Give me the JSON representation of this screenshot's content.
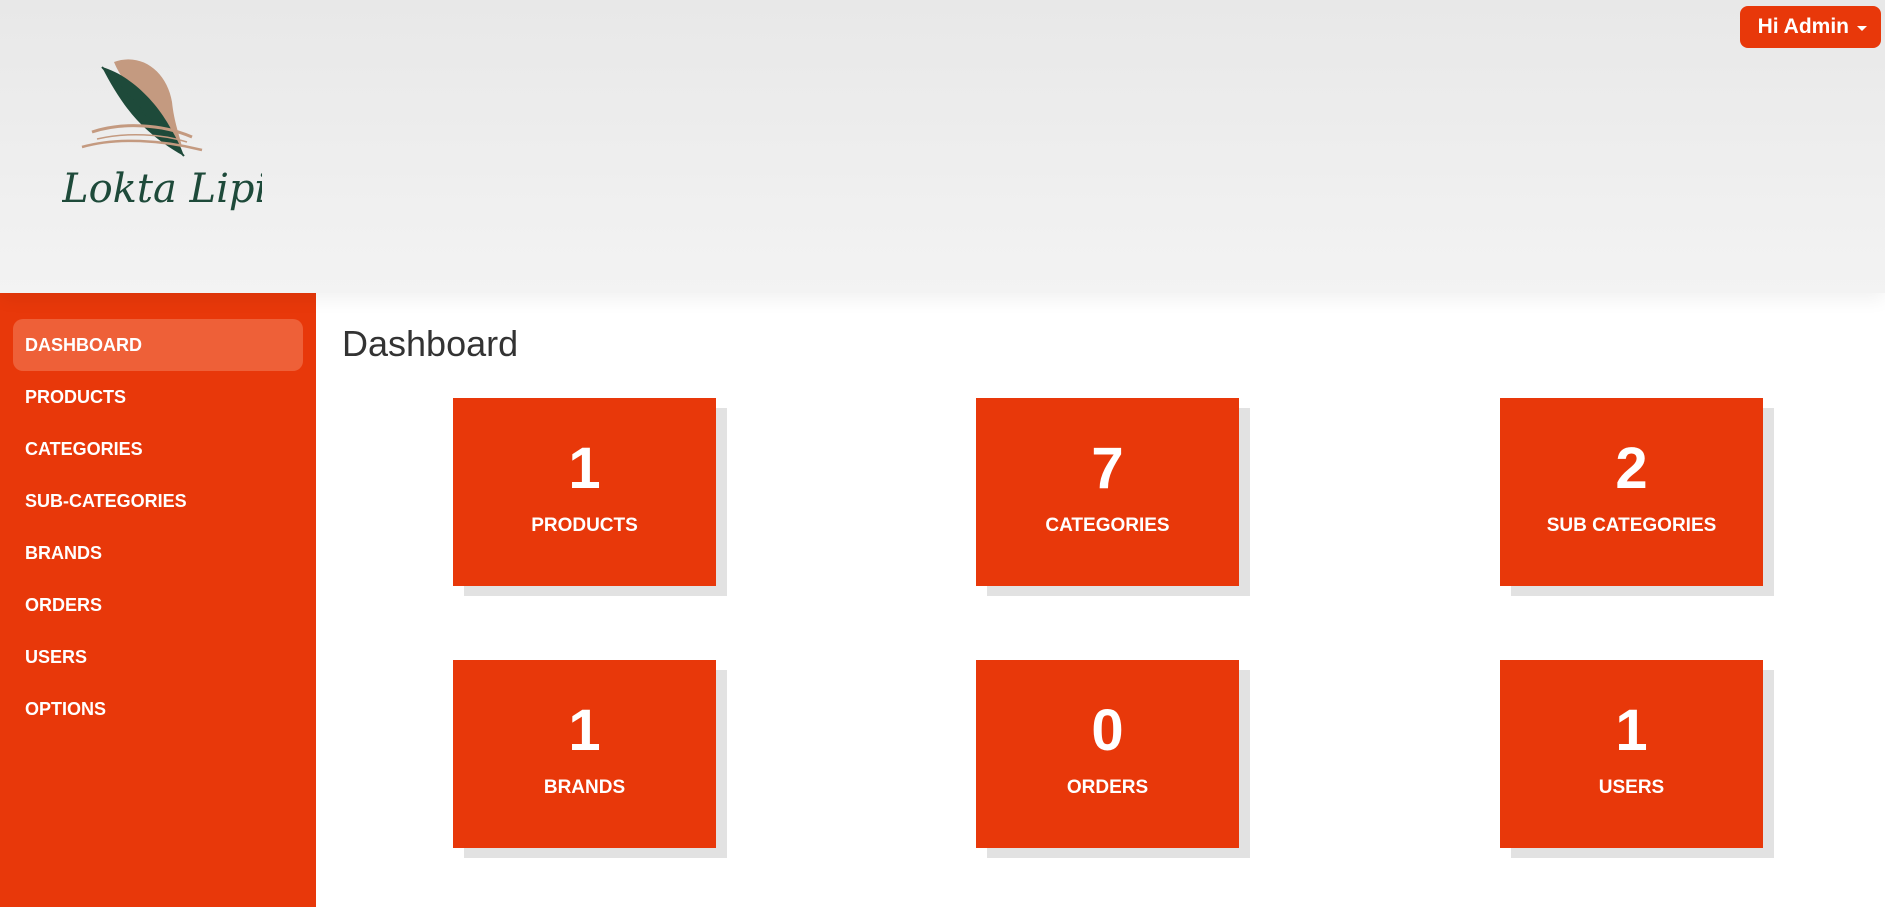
{
  "brand": {
    "logo_text": "Lokta Lipi"
  },
  "header": {
    "user_menu_label": "Hi Admin"
  },
  "sidebar": {
    "items": [
      {
        "label": "DASHBOARD",
        "active": true
      },
      {
        "label": "PRODUCTS",
        "active": false
      },
      {
        "label": "CATEGORIES",
        "active": false
      },
      {
        "label": "SUB-CATEGORIES",
        "active": false
      },
      {
        "label": "BRANDS",
        "active": false
      },
      {
        "label": "ORDERS",
        "active": false
      },
      {
        "label": "USERS",
        "active": false
      },
      {
        "label": "OPTIONS",
        "active": false
      }
    ]
  },
  "main": {
    "title": "Dashboard",
    "cards": [
      {
        "count": "1",
        "label": "PRODUCTS"
      },
      {
        "count": "7",
        "label": "CATEGORIES"
      },
      {
        "count": "2",
        "label": "SUB CATEGORIES"
      },
      {
        "count": "1",
        "label": "BRANDS"
      },
      {
        "count": "0",
        "label": "ORDERS"
      },
      {
        "count": "1",
        "label": "USERS"
      }
    ]
  },
  "colors": {
    "accent": "#e8380a",
    "active_nav": "#ee6038",
    "logo_green": "#1e4a3a",
    "logo_tan": "#c49a80"
  }
}
